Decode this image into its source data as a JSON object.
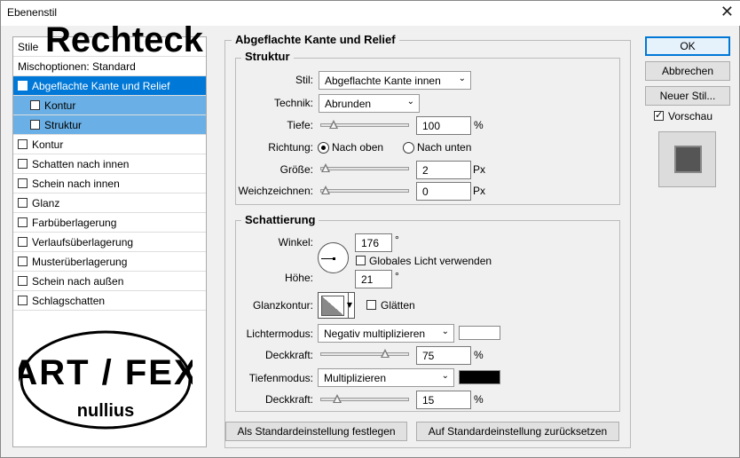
{
  "window": {
    "title": "Ebenenstil",
    "close_icon": "close-icon"
  },
  "overlay_title": "Rechteck",
  "styles_panel": {
    "header": "Stile",
    "blend_options": "Mischoptionen: Standard",
    "items": [
      {
        "label": "Abgeflachte Kante und Relief",
        "checked": true,
        "state": "selected"
      },
      {
        "label": "Kontur",
        "checked": false,
        "state": "sub"
      },
      {
        "label": "Struktur",
        "checked": false,
        "state": "sub"
      },
      {
        "label": "Kontur",
        "checked": false,
        "state": "normal"
      },
      {
        "label": "Schatten nach innen",
        "checked": false,
        "state": "normal"
      },
      {
        "label": "Schein nach innen",
        "checked": false,
        "state": "normal"
      },
      {
        "label": "Glanz",
        "checked": false,
        "state": "normal"
      },
      {
        "label": "Farbüberlagerung",
        "checked": false,
        "state": "normal"
      },
      {
        "label": "Verlaufsüberlagerung",
        "checked": false,
        "state": "normal"
      },
      {
        "label": "Musterüberlagerung",
        "checked": false,
        "state": "normal"
      },
      {
        "label": "Schein nach außen",
        "checked": false,
        "state": "normal"
      },
      {
        "label": "Schlagschatten",
        "checked": false,
        "state": "normal"
      }
    ]
  },
  "logo": {
    "line1": "ART / FEX",
    "line2": "nullius"
  },
  "main": {
    "title": "Abgeflachte Kante und Relief",
    "structure": {
      "title": "Struktur",
      "style_label": "Stil:",
      "style_value": "Abgeflachte Kante innen",
      "technique_label": "Technik:",
      "technique_value": "Abrunden",
      "depth_label": "Tiefe:",
      "depth_value": "100",
      "depth_unit": "%",
      "depth_slider": 0.1,
      "direction_label": "Richtung:",
      "direction_up": "Nach oben",
      "direction_down": "Nach unten",
      "direction_selected": "up",
      "size_label": "Größe:",
      "size_value": "2",
      "size_unit": "Px",
      "size_slider": 0.0,
      "soften_label": "Weichzeichnen:",
      "soften_value": "0",
      "soften_unit": "Px",
      "soften_slider": 0.0
    },
    "shading": {
      "title": "Schattierung",
      "angle_label": "Winkel:",
      "angle_value": "176",
      "angle_unit": "°",
      "global_light_label": "Globales Licht verwenden",
      "global_light_checked": false,
      "altitude_label": "Höhe:",
      "altitude_value": "21",
      "altitude_unit": "°",
      "gloss_contour_label": "Glanzkontur:",
      "antialias_label": "Glätten",
      "antialias_checked": false,
      "highlight_mode_label": "Lichtermodus:",
      "highlight_mode_value": "Negativ multiplizieren",
      "highlight_color": "#ffffff",
      "highlight_opacity_label": "Deckkraft:",
      "highlight_opacity_value": "75",
      "highlight_opacity_unit": "%",
      "highlight_opacity_slider": 0.75,
      "shadow_mode_label": "Tiefenmodus:",
      "shadow_mode_value": "Multiplizieren",
      "shadow_color": "#000000",
      "shadow_opacity_label": "Deckkraft:",
      "shadow_opacity_value": "15",
      "shadow_opacity_unit": "%",
      "shadow_opacity_slider": 0.15
    },
    "make_default_button": "Als Standardeinstellung festlegen",
    "reset_default_button": "Auf Standardeinstellung zurücksetzen"
  },
  "side_buttons": {
    "ok": "OK",
    "cancel": "Abbrechen",
    "new_style": "Neuer Stil...",
    "preview_label": "Vorschau",
    "preview_checked": true
  }
}
